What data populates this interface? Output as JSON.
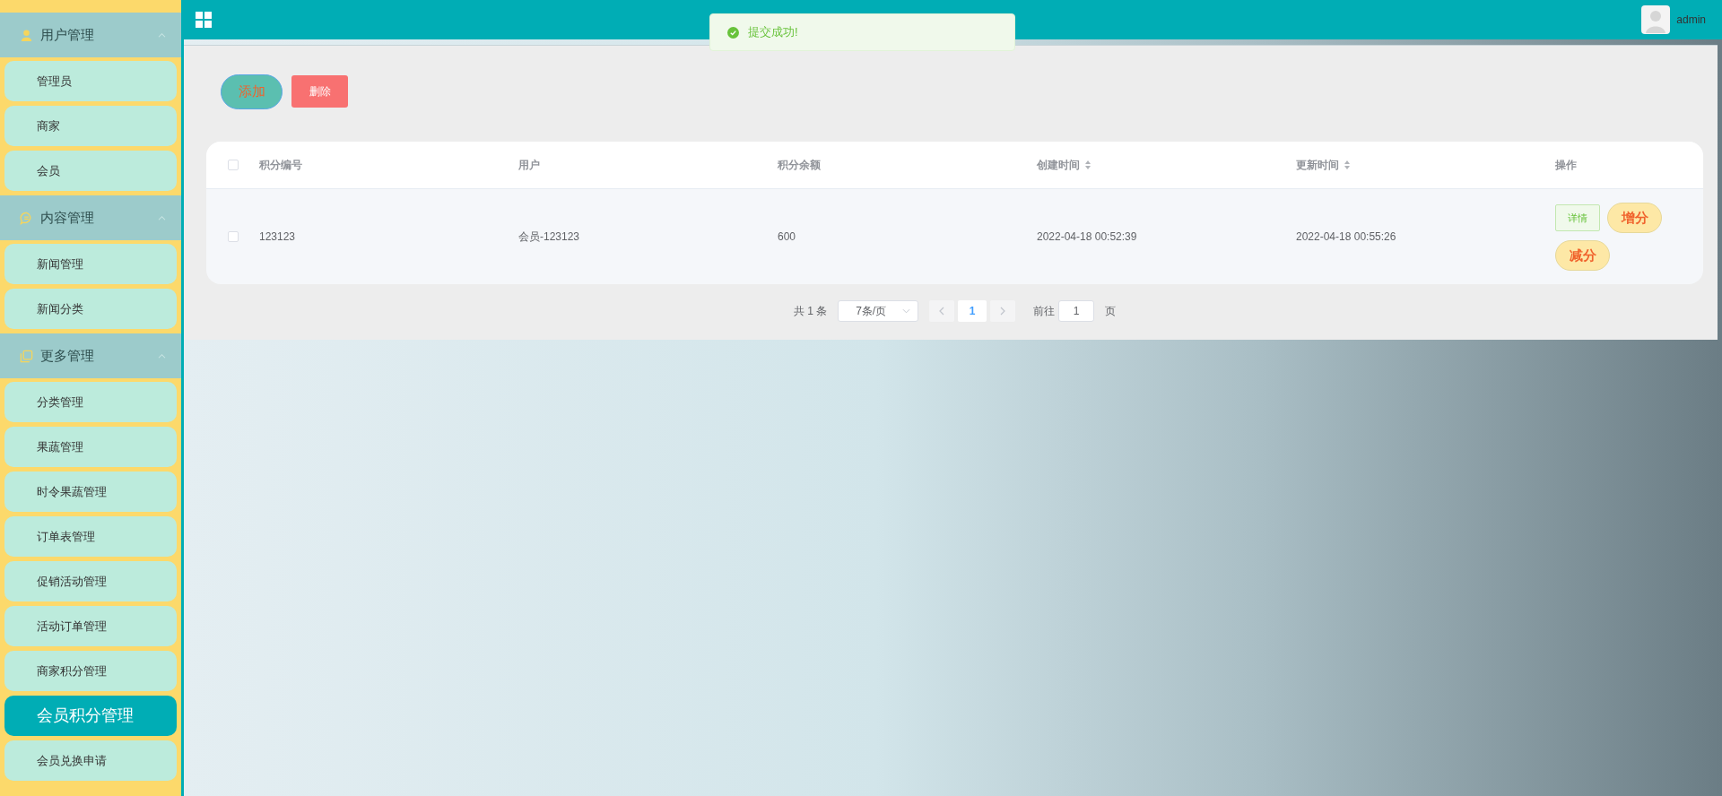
{
  "sidebar": {
    "groups": [
      {
        "label": "用户管理",
        "expanded": true,
        "items": [
          {
            "label": "管理员",
            "selected": false
          },
          {
            "label": "商家",
            "selected": false
          },
          {
            "label": "会员",
            "selected": false
          }
        ]
      },
      {
        "label": "内容管理",
        "expanded": true,
        "items": [
          {
            "label": "新闻管理",
            "selected": false
          },
          {
            "label": "新闻分类",
            "selected": false
          }
        ]
      },
      {
        "label": "更多管理",
        "expanded": true,
        "items": [
          {
            "label": "分类管理",
            "selected": false
          },
          {
            "label": "果蔬管理",
            "selected": false
          },
          {
            "label": "时令果蔬管理",
            "selected": false
          },
          {
            "label": "订单表管理",
            "selected": false
          },
          {
            "label": "促销活动管理",
            "selected": false
          },
          {
            "label": "活动订单管理",
            "selected": false
          },
          {
            "label": "商家积分管理",
            "selected": false
          },
          {
            "label": "会员积分管理",
            "selected": true
          },
          {
            "label": "会员兑换申请",
            "selected": false
          }
        ]
      }
    ]
  },
  "header": {
    "user": "admin"
  },
  "toast": {
    "message": "提交成功!"
  },
  "toolbar": {
    "buttons": [
      {
        "label": "添加",
        "kind": "add"
      },
      {
        "label": "删除",
        "kind": "delete"
      }
    ]
  },
  "table": {
    "all_checked": false,
    "columns": [
      {
        "label": "积分编号",
        "sortable": false
      },
      {
        "label": "用户",
        "sortable": false
      },
      {
        "label": "积分余额",
        "sortable": false
      },
      {
        "label": "创建时间",
        "sortable": true
      },
      {
        "label": "更新时间",
        "sortable": true
      },
      {
        "label": "操作",
        "sortable": false
      }
    ],
    "rows": [
      {
        "checked": false,
        "cells": [
          "123123",
          "会员-123123",
          "600",
          "2022-04-18 00:52:39",
          "2022-04-18 00:55:26"
        ],
        "actions": [
          {
            "label": "详情",
            "kind": "detail"
          },
          {
            "label": "增分",
            "kind": "add"
          },
          {
            "label": "减分",
            "kind": "subtract"
          }
        ]
      }
    ]
  },
  "pagination": {
    "total": "共 1 条",
    "page_size": "7条/页",
    "pages": [
      {
        "label": "1",
        "selected": true
      }
    ],
    "goto_label": "前往",
    "goto_value": "1",
    "goto_suffix": "页"
  }
}
